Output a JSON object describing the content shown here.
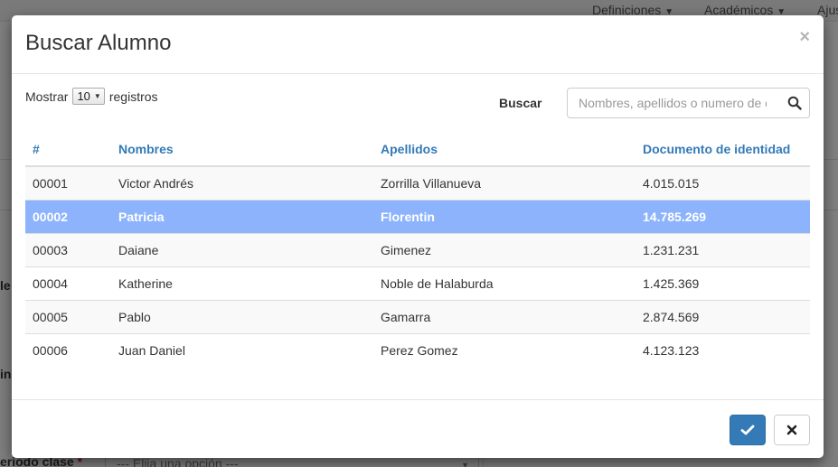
{
  "background": {
    "nav": [
      {
        "label": "Definiciones"
      },
      {
        "label": "Académicos"
      },
      {
        "label": "Ajus"
      }
    ],
    "field_labels": {
      "label_1": "le",
      "label_2": "in",
      "periodo_label": "eriodo clase",
      "periodo_required": "*"
    },
    "periodo_select_placeholder": "--- Elija una opción ---"
  },
  "modal": {
    "title": "Buscar Alumno",
    "close_symbol": "×",
    "length": {
      "prefix": "Mostrar",
      "value": "10",
      "suffix": "registros"
    },
    "search": {
      "label": "Buscar",
      "placeholder": "Nombres, apellidos o numero de documento",
      "value": ""
    },
    "table": {
      "columns": [
        "#",
        "Nombres",
        "Apellidos",
        "Documento de identidad"
      ],
      "rows": [
        {
          "id": "00001",
          "nombres": "Victor Andrés",
          "apellidos": "Zorrilla Villanueva",
          "documento": "4.015.015"
        },
        {
          "id": "00002",
          "nombres": "Patricia",
          "apellidos": "Florentin",
          "documento": "14.785.269"
        },
        {
          "id": "00003",
          "nombres": "Daiane",
          "apellidos": "Gimenez",
          "documento": "1.231.231"
        },
        {
          "id": "00004",
          "nombres": "Katherine",
          "apellidos": "Noble de Halaburda",
          "documento": "1.425.369"
        },
        {
          "id": "00005",
          "nombres": "Pablo",
          "apellidos": "Gamarra",
          "documento": "2.874.569"
        },
        {
          "id": "00006",
          "nombres": "Juan Daniel",
          "apellidos": "Perez Gomez",
          "documento": "4.123.123"
        }
      ],
      "selected_row_index": 1
    },
    "footer": {
      "accept_icon": "check-icon",
      "cancel_icon": "times-icon"
    }
  },
  "colors": {
    "primary": "#337ab7",
    "selected_row": "#8cb3fb",
    "header_text": "#337ab7"
  }
}
